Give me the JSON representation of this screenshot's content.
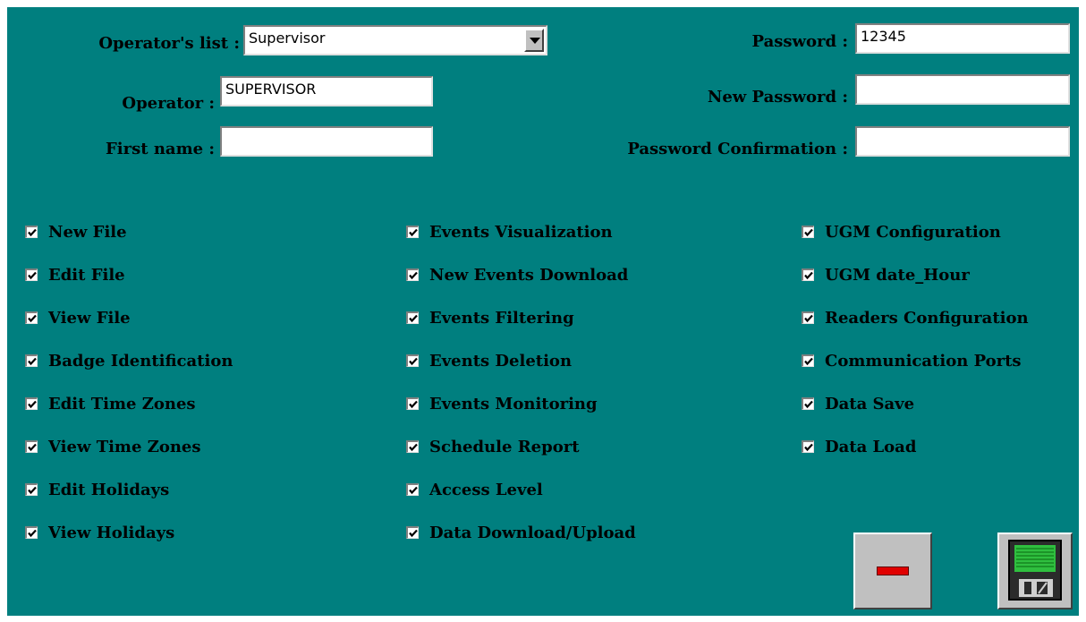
{
  "form": {
    "operators_list_label": "Operator's list :",
    "operators_list_value": "Supervisor",
    "operator_label": "Operator :",
    "operator_value": "SUPERVISOR",
    "first_name_label": "First name :",
    "first_name_value": "",
    "password_label": "Password :",
    "password_value": "12345",
    "new_password_label": "New Password :",
    "new_password_value": "",
    "password_confirmation_label": "Password Confirmation :",
    "password_confirmation_value": ""
  },
  "permissions": {
    "col1": [
      {
        "label": "New File",
        "checked": true
      },
      {
        "label": "Edit File",
        "checked": true
      },
      {
        "label": "View File",
        "checked": true
      },
      {
        "label": "Badge Identification",
        "checked": true
      },
      {
        "label": "Edit Time Zones",
        "checked": true
      },
      {
        "label": "View Time Zones",
        "checked": true
      },
      {
        "label": "Edit Holidays",
        "checked": true
      },
      {
        "label": "View Holidays",
        "checked": true
      }
    ],
    "col2": [
      {
        "label": "Events Visualization",
        "checked": true
      },
      {
        "label": "New Events Download",
        "checked": true
      },
      {
        "label": "Events Filtering",
        "checked": true
      },
      {
        "label": "Events Deletion",
        "checked": true
      },
      {
        "label": "Events Monitoring",
        "checked": true
      },
      {
        "label": "Schedule Report",
        "checked": true
      },
      {
        "label": "Access Level",
        "checked": true
      },
      {
        "label": "Data Download/Upload",
        "checked": true
      }
    ],
    "col3": [
      {
        "label": "UGM Configuration",
        "checked": true
      },
      {
        "label": "UGM date_Hour",
        "checked": true
      },
      {
        "label": "Readers Configuration",
        "checked": true
      },
      {
        "label": "Communication Ports",
        "checked": true
      },
      {
        "label": "Data Save",
        "checked": true
      },
      {
        "label": "Data Load",
        "checked": true
      }
    ]
  },
  "buttons": {
    "delete_icon": "minus-icon",
    "save_icon": "floppy-disk-icon"
  },
  "colors": {
    "background": "#007f7f",
    "accent_red": "#e00000"
  }
}
